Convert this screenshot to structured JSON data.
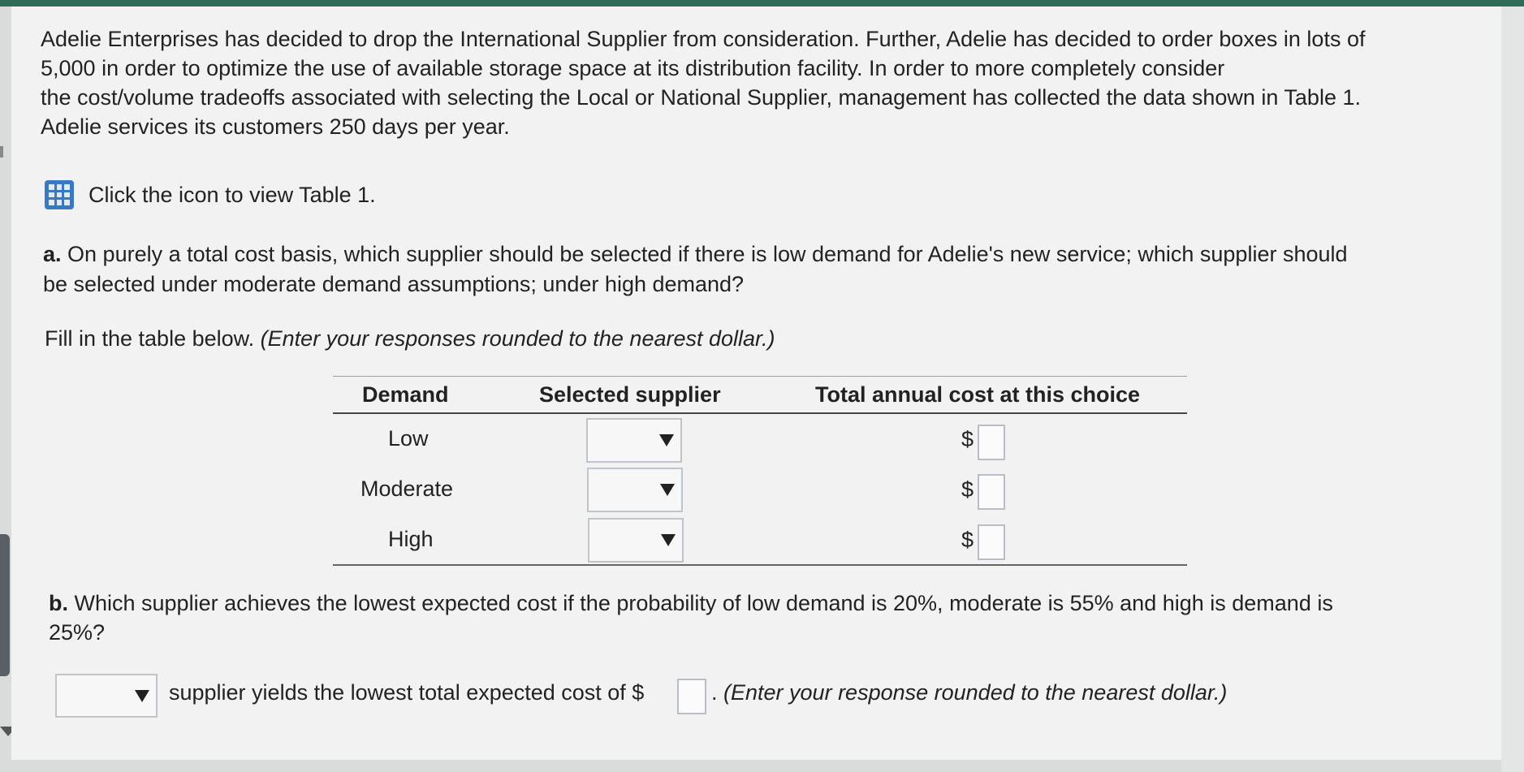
{
  "intro": {
    "lines": [
      "Adelie Enterprises has decided to drop the International Supplier from consideration. Further, Adelie has decided to order boxes in lots of",
      "5,000 in order to optimize the use of available storage space at its distribution facility. In order to more completely consider",
      "the cost/volume tradeoffs associated with selecting the Local or National Supplier, management has collected the data shown in Table 1.",
      "Adelie services its customers 250 days per year."
    ]
  },
  "table_link": {
    "text": "Click the icon to view Table 1.",
    "icon": "table-grid-icon"
  },
  "question_a": {
    "prefix": "a.",
    "line1": " On purely a total cost basis, which supplier should be selected if there is low demand for Adelie's new service; which supplier should",
    "line2": "be selected under moderate demand assumptions; under high demand?"
  },
  "instruction": {
    "plain": "Fill in the table below. ",
    "italic": "(Enter your responses rounded to the nearest dollar.)"
  },
  "table": {
    "headers": [
      "Demand",
      "Selected supplier",
      "Total annual cost at this choice"
    ],
    "rows": [
      {
        "demand": "Low",
        "supplier": "",
        "currency": "$",
        "cost": ""
      },
      {
        "demand": "Moderate",
        "supplier": "",
        "currency": "$",
        "cost": ""
      },
      {
        "demand": "High",
        "supplier": "",
        "currency": "$",
        "cost": ""
      }
    ]
  },
  "question_b": {
    "prefix": "b.",
    "line1": " Which supplier achieves the lowest expected cost if the probability of low demand is 20%, moderate is 55% and high is demand is",
    "line2": "25%?"
  },
  "answer_b": {
    "supplier": "",
    "text": "supplier yields the lowest total expected cost of $",
    "cost": "",
    "tail_plain": ". ",
    "tail_italic": "(Enter your response rounded to the nearest dollar.)"
  },
  "colors": {
    "topbar": "#2f6b57",
    "icon": "#3b78c4",
    "page": "#f1f2f1"
  }
}
